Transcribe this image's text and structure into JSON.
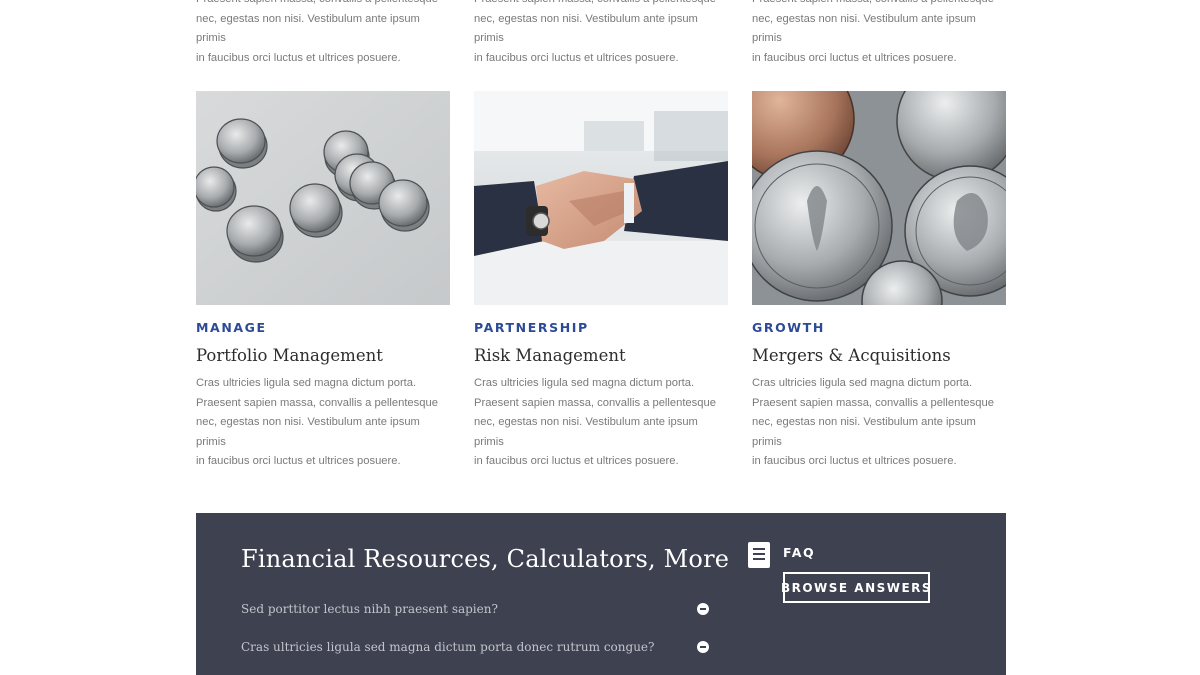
{
  "top_row": [
    {
      "lines": [
        "Praesent sapien massa, convallis a pellentesque",
        "nec, egestas non nisi. Vestibulum ante ipsum primis",
        "in faucibus orci luctus et ultrices posuere."
      ]
    },
    {
      "lines": [
        "Praesent sapien massa, convallis a pellentesque",
        "nec, egestas non nisi. Vestibulum ante ipsum primis",
        "in faucibus orci luctus et ultrices posuere."
      ]
    },
    {
      "lines": [
        "Praesent sapien massa, convallis a pellentesque",
        "nec, egestas non nisi. Vestibulum ante ipsum primis",
        "in faucibus orci luctus et ultrices posuere."
      ]
    }
  ],
  "cards": [
    {
      "tag": "MANAGE",
      "title": "Portfolio Management",
      "image": "coins-on-table-photo",
      "lines": [
        "Cras ultricies ligula sed magna dictum porta.",
        "Praesent sapien massa, convallis a pellentesque",
        "nec, egestas non nisi. Vestibulum ante ipsum primis",
        "in faucibus orci luctus et ultrices posuere."
      ]
    },
    {
      "tag": "PARTNERSHIP",
      "title": "Risk Management",
      "image": "handshake-photo",
      "lines": [
        "Cras ultricies ligula sed magna dictum porta.",
        "Praesent sapien massa, convallis a pellentesque",
        "nec, egestas non nisi. Vestibulum ante ipsum primis",
        "in faucibus orci luctus et ultrices posuere."
      ]
    },
    {
      "tag": "GROWTH",
      "title": "Mergers & Acquisitions",
      "image": "coins-closeup-photo",
      "lines": [
        "Cras ultricies ligula sed magna dictum porta.",
        "Praesent sapien massa, convallis a pellentesque",
        "nec, egestas non nisi. Vestibulum ante ipsum primis",
        "in faucibus orci luctus et ultrices posuere."
      ]
    }
  ],
  "faq_section": {
    "heading": "Financial Resources, Calculators, More",
    "questions": [
      "Sed porttitor lectus nibh praesent sapien?",
      "Cras ultricies ligula sed magna dictum porta donec rutrum congue?"
    ],
    "faq_label": "FAQ",
    "browse_button": "BROWSE ANSWERS",
    "icon": "document-icon"
  },
  "colors": {
    "accent": "#2c4a97",
    "panel_bg": "#3d4150",
    "body_text": "#7a7a7a",
    "title_text": "#2d2d2d"
  }
}
